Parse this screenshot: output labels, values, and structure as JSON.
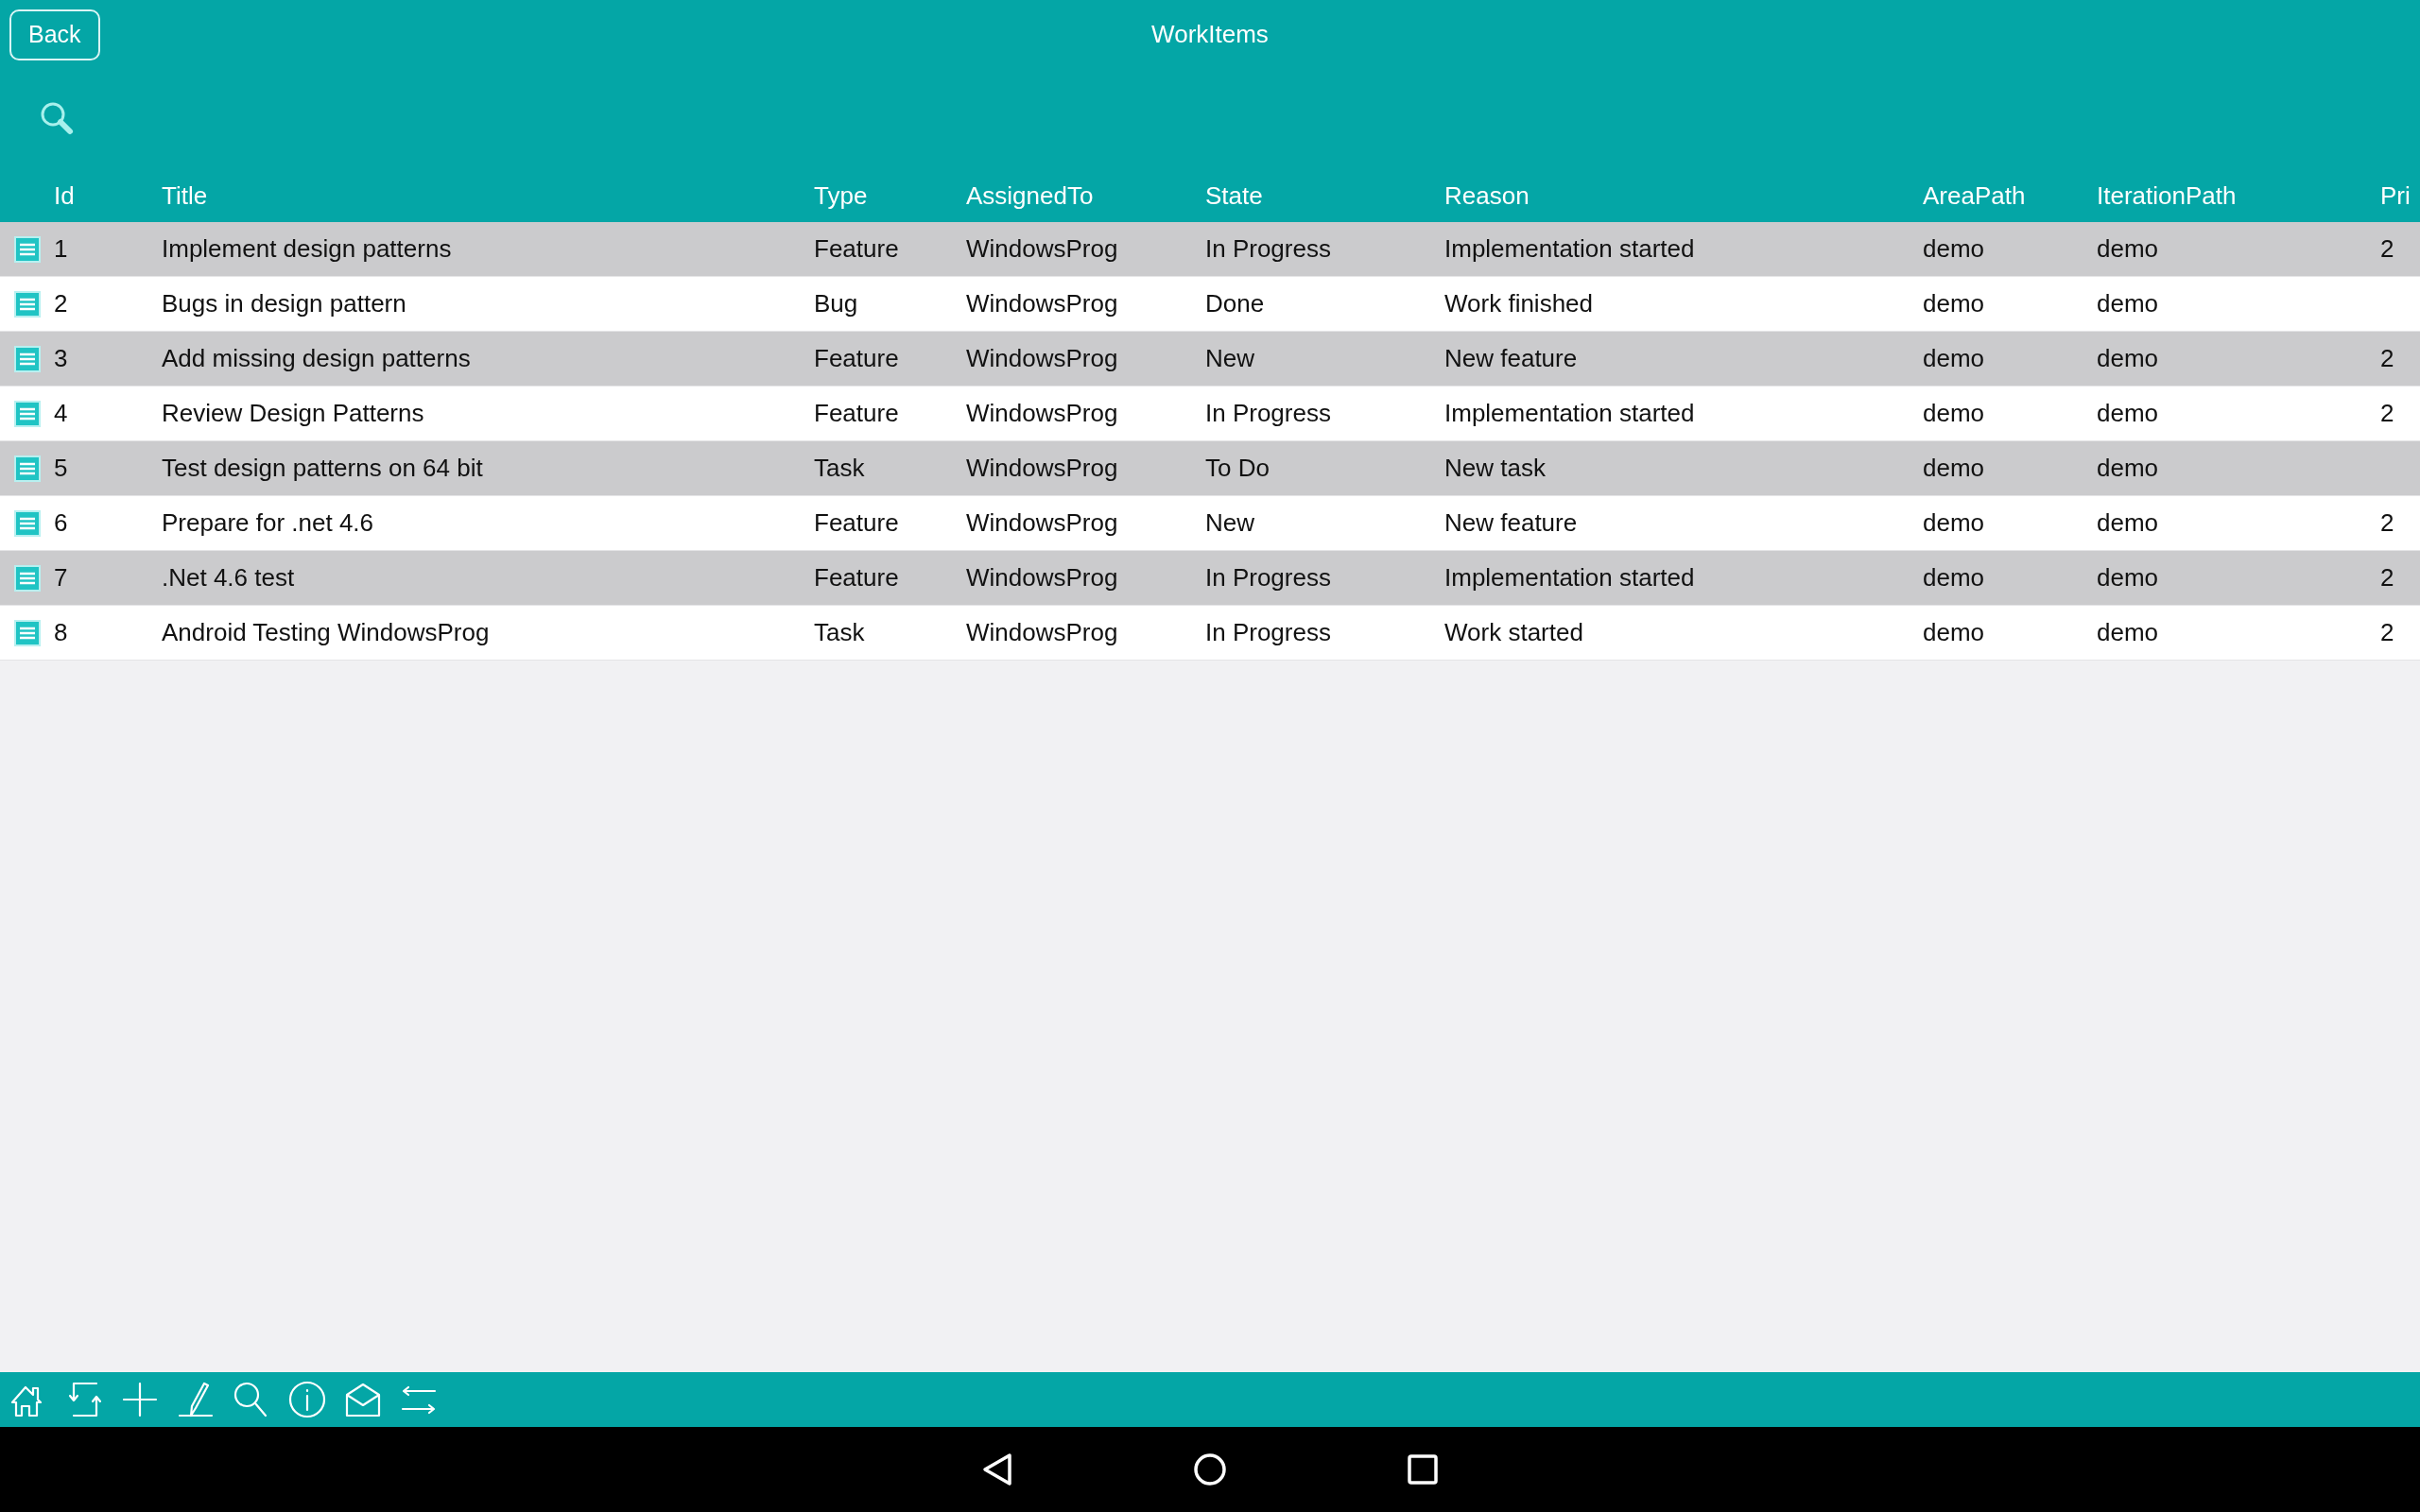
{
  "header": {
    "back_button": "Back",
    "title": "WorkItems"
  },
  "table": {
    "columns": [
      "Id",
      "Title",
      "Type",
      "AssignedTo",
      "State",
      "Reason",
      "AreaPath",
      "IterationPath",
      "Pri"
    ],
    "rows": [
      {
        "id": "1",
        "title": "Implement design patterns",
        "type": "Feature",
        "assigned_to": "WindowsProg",
        "state": "In Progress",
        "reason": "Implementation started",
        "area_path": "demo",
        "iteration_path": "demo",
        "priority": "2"
      },
      {
        "id": "2",
        "title": "Bugs in design pattern",
        "type": "Bug",
        "assigned_to": "WindowsProg",
        "state": "Done",
        "reason": "Work finished",
        "area_path": "demo",
        "iteration_path": "demo"
      },
      {
        "id": "3",
        "title": "Add missing design patterns",
        "type": "Feature",
        "assigned_to": "WindowsProg",
        "state": "New",
        "reason": "New feature",
        "area_path": "demo",
        "iteration_path": "demo",
        "priority": "2"
      },
      {
        "id": "4",
        "title": "Review Design Patterns",
        "type": "Feature",
        "assigned_to": "WindowsProg",
        "state": "In Progress",
        "reason": "Implementation started",
        "area_path": "demo",
        "iteration_path": "demo",
        "priority": "2"
      },
      {
        "id": "5",
        "title": "Test design patterns on 64 bit",
        "type": "Task",
        "assigned_to": "WindowsProg",
        "state": "To Do",
        "reason": "New task",
        "area_path": "demo",
        "iteration_path": "demo"
      },
      {
        "id": "6",
        "title": "Prepare for .net 4.6",
        "type": "Feature",
        "assigned_to": "WindowsProg",
        "state": "New",
        "reason": "New feature",
        "area_path": "demo",
        "iteration_path": "demo",
        "priority": "2"
      },
      {
        "id": "7",
        "title": ".Net 4.6 test",
        "type": "Feature",
        "assigned_to": "WindowsProg",
        "state": "In Progress",
        "reason": "Implementation started",
        "area_path": "demo",
        "iteration_path": "demo",
        "priority": "2"
      },
      {
        "id": "8",
        "title": "Android Testing WindowsProg",
        "type": "Task",
        "assigned_to": "WindowsProg",
        "state": "In Progress",
        "reason": "Work started",
        "area_path": "demo",
        "iteration_path": "demo",
        "priority": "2"
      }
    ]
  }
}
